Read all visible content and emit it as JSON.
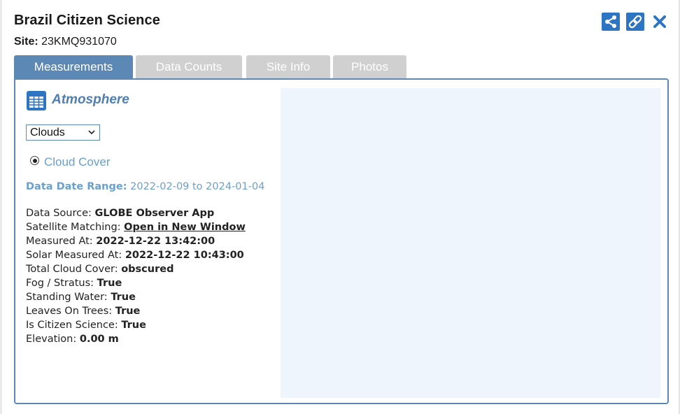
{
  "window": {
    "title": "Brazil Citizen Science",
    "site_label": "Site:",
    "site_value": "23KMQ931070"
  },
  "header_icons": [
    "share-icon",
    "link-icon",
    "close-icon"
  ],
  "tabs": [
    {
      "label": "Measurements",
      "active": true
    },
    {
      "label": "Data Counts",
      "active": false
    },
    {
      "label": "Site Info",
      "active": false
    },
    {
      "label": "Photos",
      "active": false
    }
  ],
  "section": {
    "icon": "table-icon",
    "title": "Atmosphere"
  },
  "dropdown": {
    "selected": "Clouds"
  },
  "radio": {
    "label": "Cloud Cover",
    "checked": true
  },
  "date_range": {
    "label": "Data Date Range:",
    "value": "2022-02-09 to 2024-01-04"
  },
  "info": [
    {
      "label": "Data Source: ",
      "value": "GLOBE Observer App"
    },
    {
      "label": "Satellite Matching: ",
      "value": "Open in New Window",
      "link": true
    },
    {
      "label": "Measured At: ",
      "value": "2022-12-22 13:42:00"
    },
    {
      "label": "Solar Measured At: ",
      "value": "2022-12-22 10:43:00"
    },
    {
      "label": "Total Cloud Cover: ",
      "value": "obscured"
    },
    {
      "label": "Fog / Stratus: ",
      "value": "True"
    },
    {
      "label": "Standing Water: ",
      "value": "True"
    },
    {
      "label": "Leaves On Trees: ",
      "value": "True"
    },
    {
      "label": "Is Citizen Science: ",
      "value": "True"
    },
    {
      "label": "Elevation: ",
      "value": "0.00 m"
    }
  ],
  "colors": {
    "accent": "#2d75c2",
    "tab_active": "#5b88b5",
    "tab_inactive": "#d0d0d0",
    "link_text": "#6aa0cf",
    "chart_bg": "#eff5fd"
  }
}
